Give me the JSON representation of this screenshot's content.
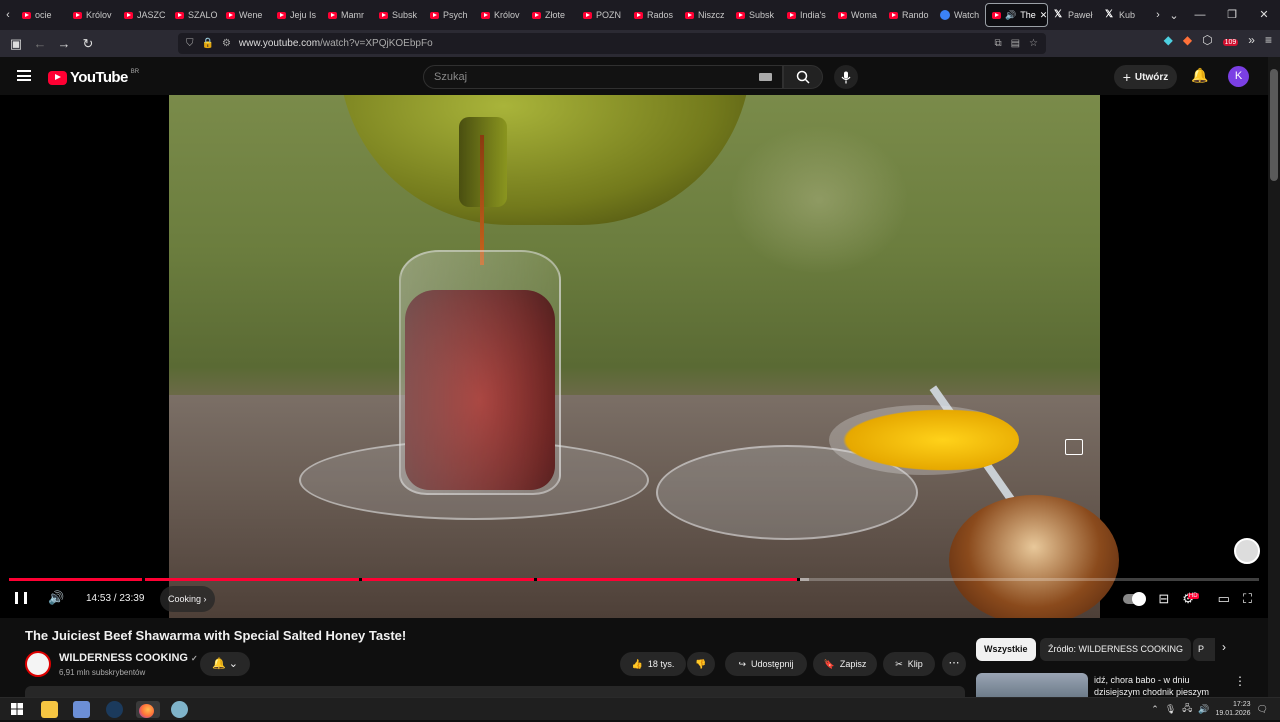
{
  "browser": {
    "tabs": [
      {
        "label": "ocie",
        "icon": "youtube-icon"
      },
      {
        "label": "Królov",
        "icon": "youtube-icon"
      },
      {
        "label": "JASZC",
        "icon": "youtube-icon"
      },
      {
        "label": "SZALO",
        "icon": "youtube-icon"
      },
      {
        "label": "Wene",
        "icon": "youtube-icon"
      },
      {
        "label": "Jeju Is",
        "icon": "youtube-icon"
      },
      {
        "label": "Mamr",
        "icon": "youtube-icon"
      },
      {
        "label": "Subsk",
        "icon": "youtube-icon"
      },
      {
        "label": "Psych",
        "icon": "youtube-icon"
      },
      {
        "label": "Królov",
        "icon": "youtube-icon"
      },
      {
        "label": "Złote",
        "icon": "youtube-icon"
      },
      {
        "label": "POZN",
        "icon": "youtube-icon"
      },
      {
        "label": "Rados",
        "icon": "youtube-icon"
      },
      {
        "label": "Niszcz",
        "icon": "youtube-icon"
      },
      {
        "label": "Subsk",
        "icon": "youtube-icon"
      },
      {
        "label": "India's",
        "icon": "youtube-icon"
      },
      {
        "label": "Woma",
        "icon": "youtube-icon"
      },
      {
        "label": "Rando",
        "icon": "youtube-icon"
      },
      {
        "label": "Watch",
        "icon": "globe-icon"
      }
    ],
    "active_tab": "The",
    "after_tabs": [
      {
        "label": "Paweł",
        "icon": "x-icon"
      },
      {
        "label": "Kub",
        "icon": "x-icon"
      }
    ],
    "url_host": "www.youtube.com",
    "url_path": "/watch?v=XPQjKOEbpFo",
    "extension_badge": "109"
  },
  "youtube": {
    "logo_text": "YouTube",
    "country_code": "BR",
    "search_placeholder": "Szukaj",
    "create_label": "Utwórz",
    "avatar_letter": "K"
  },
  "player": {
    "current_time": "14:53",
    "duration": "23:39",
    "time_separator": " / ",
    "chapter": "Cooking",
    "progress_played": 0.63,
    "progress_loaded": 0.64,
    "chapter_marks": [
      0.106,
      0.28,
      0.42,
      0.63
    ]
  },
  "video": {
    "title": "The Juiciest Beef Shawarma with Special Salted Honey Taste!",
    "channel": "WILDERNESS COOKING",
    "verified": "✓",
    "subscribers": "6,91 mln subskrybentów",
    "likes": "18 tys.",
    "share_label": "Udostępnij",
    "save_label": "Zapisz",
    "clip_label": "Klip"
  },
  "recommendations": {
    "chips": [
      "Wszystkie",
      "Źródło: WILDERNESS COOKING",
      "P"
    ],
    "first_title": "idź, chora babo - w dniu dzisiejszym chodnik pieszym"
  },
  "taskbar": {
    "time": "17:23",
    "date": "19.01.2026"
  }
}
